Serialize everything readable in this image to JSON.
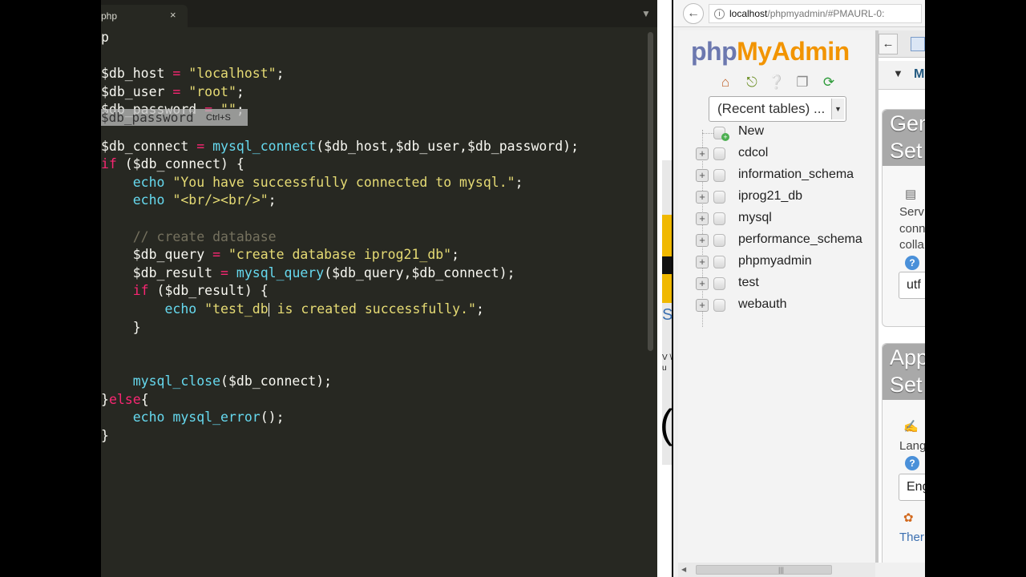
{
  "editor": {
    "tab_label": "php",
    "tab_close": "×",
    "tab_menu": "▼",
    "code_lines": [
      [
        {
          "c": "plain",
          "t": "p"
        }
      ],
      [],
      [
        {
          "c": "var",
          "t": "$db_host"
        },
        {
          "c": "op",
          "t": " = "
        },
        {
          "c": "str",
          "t": "\"localhost\""
        },
        {
          "c": "plain",
          "t": ";"
        }
      ],
      [
        {
          "c": "var",
          "t": "$db_user"
        },
        {
          "c": "op",
          "t": " = "
        },
        {
          "c": "str",
          "t": "\"root\""
        },
        {
          "c": "plain",
          "t": ";"
        }
      ],
      [
        {
          "c": "var",
          "t": "$db_password"
        },
        {
          "c": "op",
          "t": " = "
        },
        {
          "c": "str",
          "t": "\"\""
        },
        {
          "c": "plain",
          "t": ";"
        }
      ],
      [],
      [
        {
          "c": "var",
          "t": "$db_connect"
        },
        {
          "c": "op",
          "t": " = "
        },
        {
          "c": "fn",
          "t": "mysql_connect"
        },
        {
          "c": "plain",
          "t": "($db_host,$db_user,$db_password);"
        }
      ],
      [
        {
          "c": "kw",
          "t": "if"
        },
        {
          "c": "plain",
          "t": " ($db_connect) {"
        }
      ],
      [
        {
          "c": "plain",
          "t": "    "
        },
        {
          "c": "fn",
          "t": "echo"
        },
        {
          "c": "plain",
          "t": " "
        },
        {
          "c": "str",
          "t": "\"You have successfully connected to mysql.\""
        },
        {
          "c": "plain",
          "t": ";"
        }
      ],
      [
        {
          "c": "plain",
          "t": "    "
        },
        {
          "c": "fn",
          "t": "echo"
        },
        {
          "c": "plain",
          "t": " "
        },
        {
          "c": "str",
          "t": "\"<br/><br/>\""
        },
        {
          "c": "plain",
          "t": ";"
        }
      ],
      [],
      [
        {
          "c": "plain",
          "t": "    "
        },
        {
          "c": "cm",
          "t": "// create database"
        }
      ],
      [
        {
          "c": "plain",
          "t": "    "
        },
        {
          "c": "var",
          "t": "$db_query"
        },
        {
          "c": "op",
          "t": " = "
        },
        {
          "c": "str",
          "t": "\"create database iprog21_db\""
        },
        {
          "c": "plain",
          "t": ";"
        }
      ],
      [
        {
          "c": "plain",
          "t": "    "
        },
        {
          "c": "var",
          "t": "$db_result"
        },
        {
          "c": "op",
          "t": " = "
        },
        {
          "c": "fn",
          "t": "mysql_query"
        },
        {
          "c": "plain",
          "t": "($db_query,$db_connect);"
        }
      ],
      [
        {
          "c": "plain",
          "t": "    "
        },
        {
          "c": "kw",
          "t": "if"
        },
        {
          "c": "plain",
          "t": " ($db_result) {"
        }
      ],
      [
        {
          "c": "plain",
          "t": "        "
        },
        {
          "c": "fn",
          "t": "echo"
        },
        {
          "c": "plain",
          "t": " "
        },
        {
          "c": "str",
          "t": "\"test_db is created successfully.\""
        },
        {
          "c": "plain",
          "t": ";"
        }
      ],
      [
        {
          "c": "plain",
          "t": "    }"
        }
      ],
      [],
      [],
      [
        {
          "c": "plain",
          "t": "    "
        },
        {
          "c": "fn",
          "t": "mysql_close"
        },
        {
          "c": "plain",
          "t": "($db_connect);"
        }
      ],
      [
        {
          "c": "plain",
          "t": "}"
        },
        {
          "c": "kw",
          "t": "else"
        },
        {
          "c": "plain",
          "t": "{"
        }
      ],
      [
        {
          "c": "plain",
          "t": "    "
        },
        {
          "c": "fn",
          "t": "echo"
        },
        {
          "c": "plain",
          "t": " "
        },
        {
          "c": "fn",
          "t": "mysql_error"
        },
        {
          "c": "plain",
          "t": "();"
        }
      ],
      [
        {
          "c": "plain",
          "t": "}"
        }
      ]
    ],
    "tooltip_text": "$db_password",
    "tooltip_shortcut": "Ctrl+S"
  },
  "browser": {
    "back_icon": "back-arrow-icon",
    "url_host": "localhost",
    "url_path": "/phpmyadmin/#PMAURL-0:",
    "info_glyph": "i"
  },
  "pma": {
    "logo_php": "php",
    "logo_my": "My",
    "logo_admin": "Admin",
    "recent_tables": "(Recent tables) ...",
    "new_label": "New",
    "databases": [
      "cdcol",
      "information_schema",
      "iprog21_db",
      "mysql",
      "performance_schema",
      "phpmyadmin",
      "test",
      "webauth"
    ],
    "quick_icons": [
      "home-icon",
      "logout-icon",
      "help-icon",
      "docs-icon",
      "reload-icon"
    ],
    "main_menu_letter": "M",
    "section1_title_1": "Gen",
    "section1_title_2": "Set",
    "section1_lines": [
      "Serv",
      "conn",
      "colla"
    ],
    "section1_input": "utf",
    "section2_title_1": "App",
    "section2_title_2": "Set",
    "section2_lang": "Lang",
    "section2_input": "Eng",
    "section2_theme": "Ther"
  },
  "left_window_fragment": {
    "text_s": "S",
    "text_lines": [
      "V \\",
      "u"
    ],
    "big_glyph": "("
  },
  "colors": {
    "editor_bg": "#272822",
    "keyword": "#f92672",
    "string": "#e6db74",
    "function": "#66d9ef",
    "comment": "#75715e",
    "pma_blue": "#6c78af",
    "pma_orange": "#f29400"
  }
}
